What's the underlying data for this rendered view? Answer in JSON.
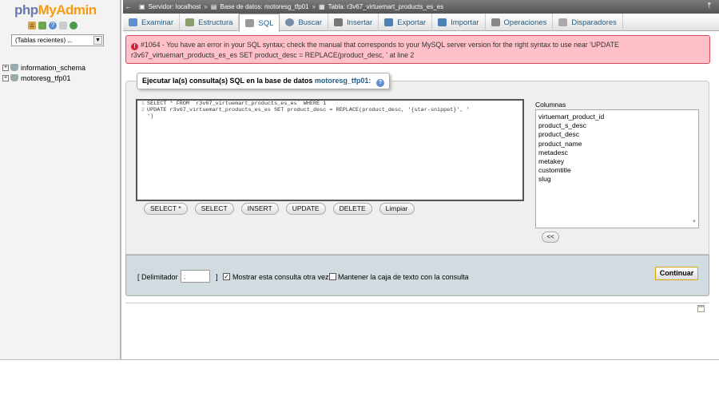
{
  "sidebar": {
    "logo_php": "php",
    "logo_myadmin": "MyAdmin",
    "icons": [
      "home-icon",
      "exit-icon",
      "help-icon",
      "docs-icon",
      "reload-icon"
    ],
    "recent_tables": "(Tablas recientes) ...",
    "databases": [
      {
        "name": "information_schema"
      },
      {
        "name": "motoresg_tfp01"
      }
    ]
  },
  "breadcrumb": {
    "server": "Servidor: localhost",
    "database": "Base de datos: motoresg_tfp01",
    "table": "Tabla: r3v67_virtuemart_products_es_es",
    "separator": "»"
  },
  "tabs": [
    {
      "label": "Examinar",
      "icon": "browse-icon",
      "color": "#5b8fcf"
    },
    {
      "label": "Estructura",
      "icon": "structure-icon",
      "color": "#8a9e6b"
    },
    {
      "label": "SQL",
      "icon": "sql-icon",
      "color": "#999"
    },
    {
      "label": "Buscar",
      "icon": "search-icon",
      "color": "#7a8aa9"
    },
    {
      "label": "Insertar",
      "icon": "insert-icon",
      "color": "#777"
    },
    {
      "label": "Exportar",
      "icon": "export-icon",
      "color": "#4d7fb8"
    },
    {
      "label": "Importar",
      "icon": "import-icon",
      "color": "#4d7fb8"
    },
    {
      "label": "Operaciones",
      "icon": "wrench-icon",
      "color": "#888"
    },
    {
      "label": "Disparadores",
      "icon": "triggers-icon",
      "color": "#aaa"
    }
  ],
  "active_tab": "SQL",
  "error": {
    "line1": "#1064 - You have an error in your SQL syntax; check the manual that corresponds to your MySQL server version for the right syntax to use near 'UPDATE",
    "line2": "r3v67_virtuemart_products_es_es SET product_desc = REPLACE(product_desc, ' at line 2",
    "bg_color": "#ffc0c8",
    "border_color": "#d94b5c"
  },
  "query_box": {
    "legend": "Ejecutar la(s) consulta(s) SQL en la base de datos",
    "db_name": "motoresg_tfp01:",
    "lines": [
      {
        "num": "1",
        "text": "SELECT * FROM `r3v67_virtuemart_products_es_es` WHERE 1"
      },
      {
        "num": "2",
        "text": "UPDATE r3v67_virtuemart_products_es_es SET product_desc = REPLACE(product_desc, '{star-snippet}', '"
      },
      {
        "num": "",
        "text": "')"
      }
    ],
    "buttons": [
      "SELECT *",
      "SELECT",
      "INSERT",
      "UPDATE",
      "DELETE",
      "Limpiar"
    ],
    "columns_label": "Columnas",
    "columns": [
      "virtuemart_product_id",
      "product_s_desc",
      "product_desc",
      "product_name",
      "metadesc",
      "metakey",
      "customtitle",
      "slug"
    ],
    "insert_button": "<<"
  },
  "footer": {
    "delimiter_open": "[ Delimitador",
    "delimiter_value": ";",
    "delimiter_close": "]",
    "show_again_label": "Mostrar esta consulta otra vez",
    "show_again_checked": true,
    "keep_box_label": "Mantener la caja de texto con la consulta",
    "keep_box_checked": false,
    "submit_label": "Continuar"
  }
}
